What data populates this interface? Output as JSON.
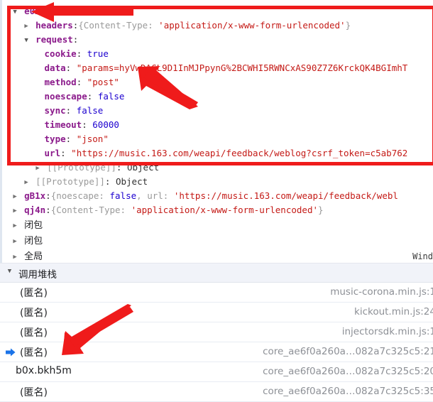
{
  "meta": {
    "accent_red": "#ef1b1b",
    "prop_color": "#8b1a8b",
    "string_color": "#c41a16",
    "number_color": "#1c00cf",
    "muted_color": "#9a9a9a"
  },
  "scope_pane": {
    "rows": [
      {
        "id": "e0x",
        "indent": 0,
        "toggle": "open",
        "prop": "e0x",
        "sep": ":",
        "value_parts": []
      },
      {
        "id": "headers",
        "indent": 1,
        "toggle": "closed",
        "prop": "headers",
        "sep": ":",
        "value_parts": [
          {
            "t": "grey",
            "s": "{Content-Type: "
          },
          {
            "t": "str",
            "s": "'application/x-www-form-urlencoded'"
          },
          {
            "t": "grey",
            "s": "}"
          }
        ]
      },
      {
        "id": "request",
        "indent": 1,
        "toggle": "open",
        "prop": "request",
        "sep": ":",
        "value_parts": []
      },
      {
        "id": "cookie",
        "indent": 2,
        "toggle": "none",
        "prop": "cookie",
        "sep": ": ",
        "value_parts": [
          {
            "t": "bool",
            "s": "true"
          }
        ]
      },
      {
        "id": "data",
        "indent": 2,
        "toggle": "none",
        "prop": "data",
        "sep": ": ",
        "value_parts": [
          {
            "t": "str",
            "s": "\"params=hyVwDACL9D1InMJPpynG%2BCWHI5RWNCxAS90Z7Z6KrckQK4BGImhT"
          }
        ]
      },
      {
        "id": "method",
        "indent": 2,
        "toggle": "none",
        "prop": "method",
        "sep": ": ",
        "value_parts": [
          {
            "t": "str",
            "s": "\"post\""
          }
        ]
      },
      {
        "id": "noescape",
        "indent": 2,
        "toggle": "none",
        "prop": "noescape",
        "sep": ": ",
        "value_parts": [
          {
            "t": "bool",
            "s": "false"
          }
        ]
      },
      {
        "id": "sync",
        "indent": 2,
        "toggle": "none",
        "prop": "sync",
        "sep": ": ",
        "value_parts": [
          {
            "t": "bool",
            "s": "false"
          }
        ]
      },
      {
        "id": "timeout",
        "indent": 2,
        "toggle": "none",
        "prop": "timeout",
        "sep": ": ",
        "value_parts": [
          {
            "t": "num",
            "s": "60000"
          }
        ]
      },
      {
        "id": "type",
        "indent": 2,
        "toggle": "none",
        "prop": "type",
        "sep": ": ",
        "value_parts": [
          {
            "t": "str",
            "s": "\"json\""
          }
        ]
      },
      {
        "id": "url",
        "indent": 2,
        "toggle": "none",
        "prop": "url",
        "sep": ": ",
        "value_parts": [
          {
            "t": "str",
            "s": "\"https://music.163.com/weapi/feedback/weblog?csrf_token=c5ab762"
          }
        ]
      },
      {
        "id": "proto-inner",
        "indent": 2,
        "toggle": "closed",
        "prop": "",
        "sep": "",
        "value_parts": [
          {
            "t": "grey",
            "s": "[[Prototype]]"
          },
          {
            "t": "punct",
            "s": ": "
          },
          {
            "t": "obj",
            "s": "Object"
          }
        ]
      },
      {
        "id": "proto-outer",
        "indent": 1,
        "toggle": "closed",
        "prop": "",
        "sep": "",
        "value_parts": [
          {
            "t": "grey",
            "s": "[[Prototype]]"
          },
          {
            "t": "punct",
            "s": ": "
          },
          {
            "t": "obj",
            "s": "Object"
          }
        ]
      },
      {
        "id": "gB1x",
        "indent": 0,
        "toggle": "closed",
        "prop": "gB1x",
        "sep": ":",
        "value_parts": [
          {
            "t": "grey",
            "s": "{noescape: "
          },
          {
            "t": "bool",
            "s": "false"
          },
          {
            "t": "grey",
            "s": ", url: "
          },
          {
            "t": "str",
            "s": "'https://music.163.com/weapi/feedback/webl"
          }
        ]
      },
      {
        "id": "qj4n",
        "indent": 0,
        "toggle": "closed",
        "prop": "qj4n",
        "sep": ":",
        "value_parts": [
          {
            "t": "grey",
            "s": "{Content-Type: "
          },
          {
            "t": "str",
            "s": "'application/x-www-form-urlencoded'"
          },
          {
            "t": "grey",
            "s": "}"
          }
        ]
      },
      {
        "id": "closure-1",
        "indent": 0,
        "toggle": "closed",
        "cjk_label": "闭包",
        "value_parts": []
      },
      {
        "id": "closure-2",
        "indent": 0,
        "toggle": "closed",
        "cjk_label": "闭包",
        "value_parts": []
      },
      {
        "id": "global",
        "indent": 0,
        "toggle": "closed",
        "cjk_label": "全局",
        "right_label": "Wind",
        "value_parts": []
      }
    ]
  },
  "call_stack": {
    "title": "调用堆栈",
    "anonymous_label": "(匿名)",
    "frames": [
      {
        "name": "(匿名)",
        "location": "music-corona.min.js:1",
        "active": false
      },
      {
        "name": "(匿名)",
        "location": "kickout.min.js:24",
        "active": false
      },
      {
        "name": "(匿名)",
        "location": "injectorsdk.min.js:1",
        "active": false
      },
      {
        "name": "(匿名)",
        "location": "core_ae6f0a260a…082a7c325c5:21",
        "active": true
      },
      {
        "name": "b0x.bkh5m",
        "location": "core_ae6f0a260a…082a7c325c5:20",
        "active": false
      },
      {
        "name": "(匿名)",
        "location": "core_ae6f0a260a…082a7c325c5:35",
        "active": false
      }
    ]
  },
  "annotations": {
    "box_label": "highlight-request-object",
    "arrow_1": "points-to-e0x",
    "arrow_2": "points-to-data-value",
    "arrow_3": "points-to-active-stack-frame"
  }
}
